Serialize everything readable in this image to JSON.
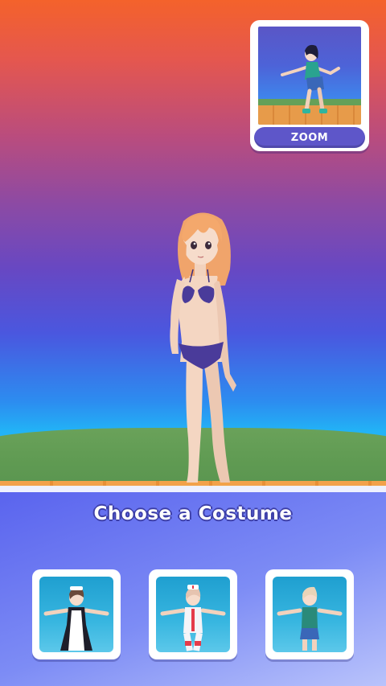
{
  "zoom": {
    "button_label": "ZOOM"
  },
  "panel": {
    "title": "Choose a Costume"
  },
  "costumes": [
    {
      "name": "maid",
      "icon": "maid-costume-icon"
    },
    {
      "name": "nurse",
      "icon": "nurse-costume-icon"
    },
    {
      "name": "casual",
      "icon": "casual-costume-icon"
    }
  ],
  "colors": {
    "panel_accent": "#5a64ee",
    "zoom_button": "#5e56c9",
    "title_outline": "#3d3fa8"
  }
}
